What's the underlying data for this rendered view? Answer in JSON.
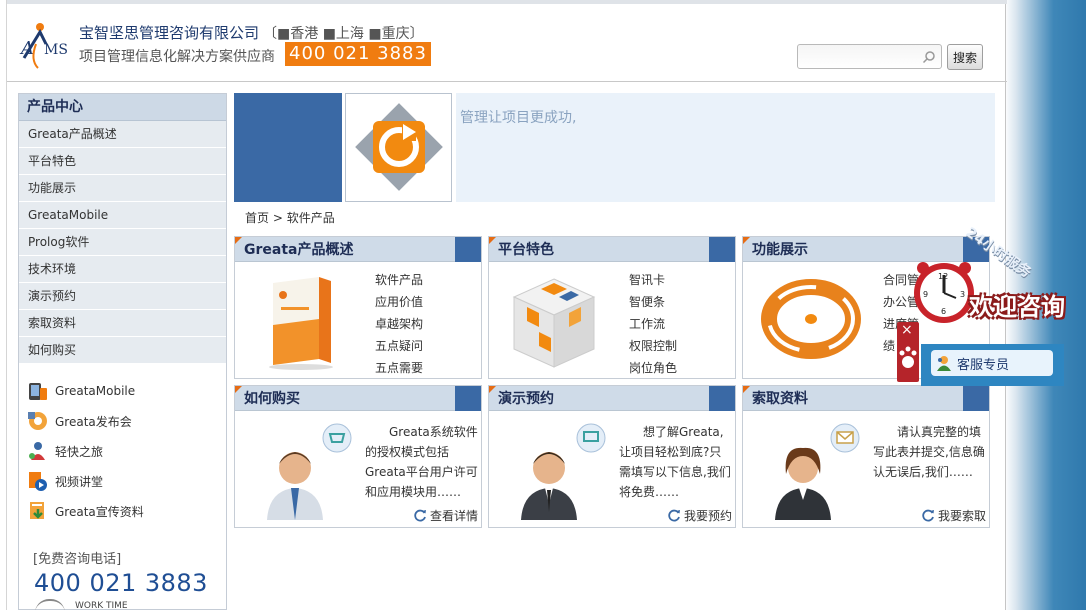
{
  "header": {
    "company_name": "宝智坚思管理咨询有限公司",
    "cities": "〔■香港  ■上海  ■重庆〕",
    "slogan": "项目管理信息化解决方案供应商",
    "hotline": "400 021 3883",
    "search_placeholder": "",
    "search_button": "搜索"
  },
  "sidebar": {
    "title": "产品中心",
    "items": [
      "Greata产品概述",
      "平台特色",
      "功能展示",
      "GreataMobile",
      "Prolog软件",
      "技术环境",
      "演示预约",
      "索取资料",
      "如何购买"
    ],
    "links": [
      "GreataMobile",
      "Greata发布会",
      "轻快之旅",
      "视频讲堂",
      "Greata宣传资料"
    ],
    "free_call_label": "[免费咨询电话]",
    "free_call_number": "400 021 3883",
    "worktime": "WORK TIME"
  },
  "banner": {
    "text": "管理让项目更成功,"
  },
  "breadcrumb": {
    "home": "首页",
    "sep": " > ",
    "current": "软件产品"
  },
  "cards": [
    {
      "title": "Greata产品概述",
      "links": [
        "软件产品",
        "应用价值",
        "卓越架构",
        "五点疑问",
        "五点需要"
      ]
    },
    {
      "title": "平台特色",
      "links": [
        "智讯卡",
        "智便条",
        "工作流",
        "权限控制",
        "岗位角色"
      ]
    },
    {
      "title": "功能展示",
      "links": [
        "合同管",
        "办公管",
        "进度管",
        "绩"
      ]
    },
    {
      "title": "如何购买",
      "desc": "Greata系统软件的授权模式包括Greata平台用户许可和应用模块用……",
      "more": "查看详情"
    },
    {
      "title": "演示预约",
      "desc": "想了解Greata,让项目轻松到底?只需填写以下信息,我们将免费……",
      "more": "我要预约"
    },
    {
      "title": "索取资料",
      "desc": "请认真完整的填写此表并提交,信息确认无误后,我们……",
      "more": "我要索取"
    }
  ],
  "consult": {
    "service_hours": "24小时服务",
    "welcome": "欢迎咨询",
    "agent_label": "客服专员",
    "close": "×"
  },
  "colors": {
    "accent_blue": "#3a69a5",
    "hotline_orange": "#f07c10",
    "card_head": "#cfdbe8"
  }
}
